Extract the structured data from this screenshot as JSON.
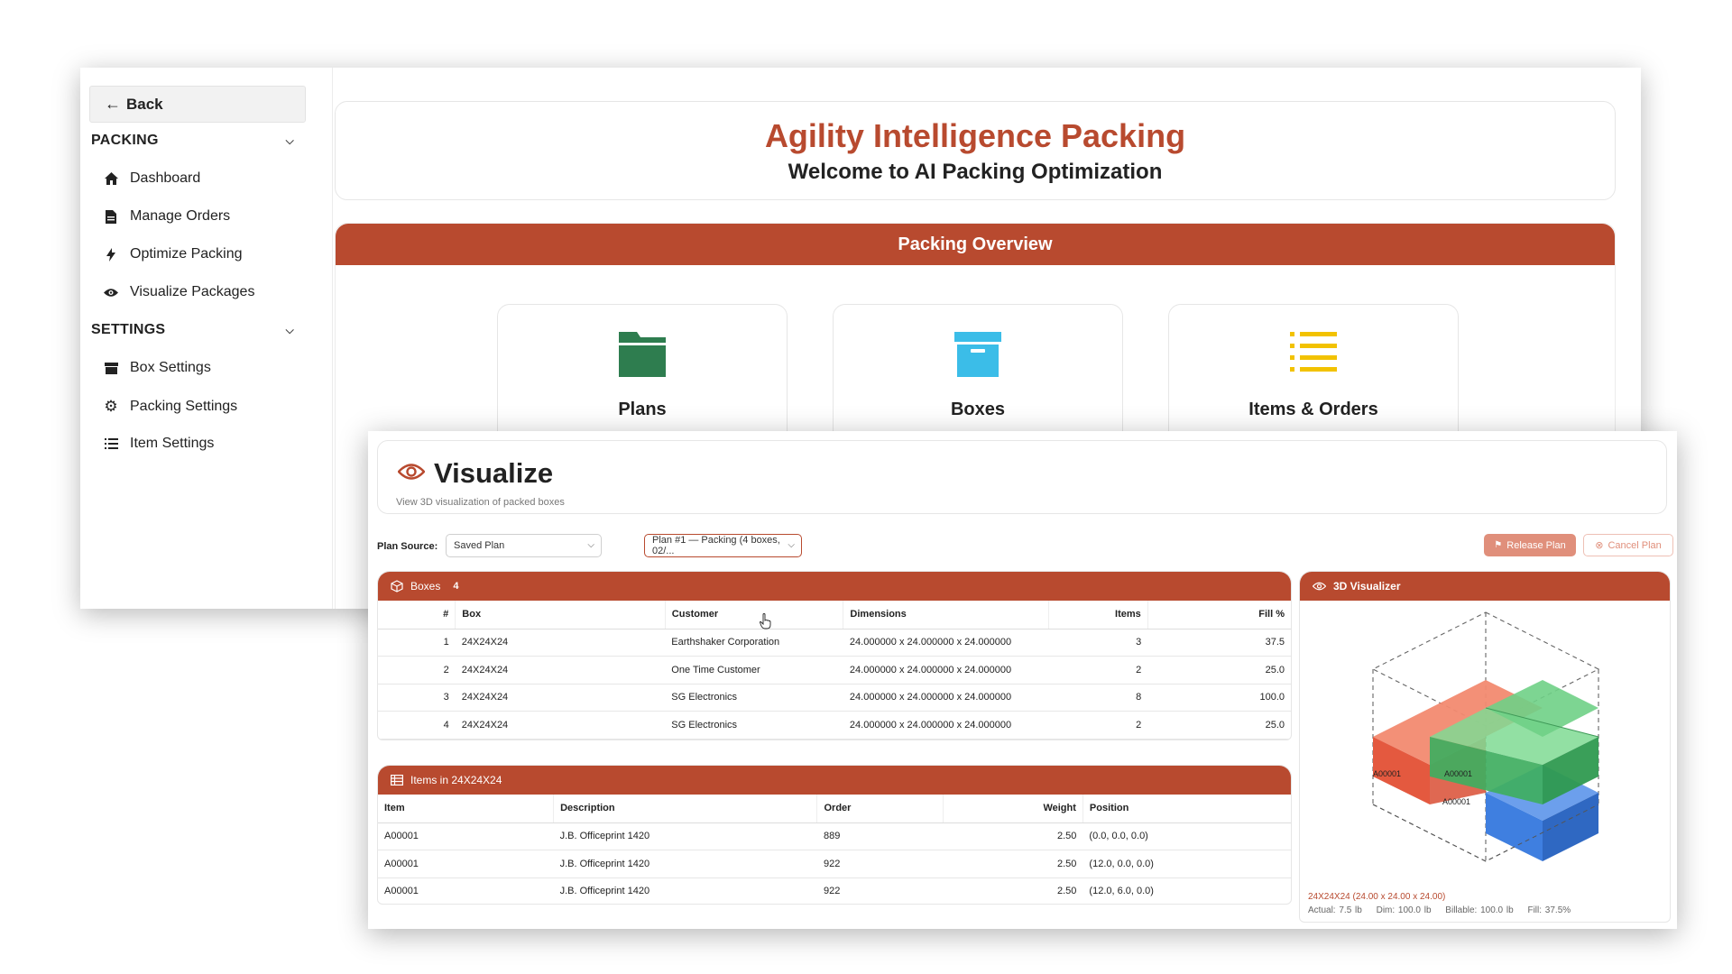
{
  "sidebar": {
    "back_label": "Back",
    "sections": [
      {
        "title": "PACKING",
        "items": [
          {
            "label": "Dashboard",
            "icon": "home-icon"
          },
          {
            "label": "Manage Orders",
            "icon": "document-icon"
          },
          {
            "label": "Optimize Packing",
            "icon": "lightning-icon"
          },
          {
            "label": "Visualize Packages",
            "icon": "eye-icon"
          }
        ]
      },
      {
        "title": "SETTINGS",
        "items": [
          {
            "label": "Box Settings",
            "icon": "box-icon"
          },
          {
            "label": "Packing Settings",
            "icon": "gear-icon"
          },
          {
            "label": "Item Settings",
            "icon": "list-icon"
          }
        ]
      }
    ]
  },
  "hero": {
    "title": "Agility Intelligence Packing",
    "subtitle": "Welcome to AI Packing Optimization"
  },
  "overview": {
    "header": "Packing Overview",
    "cards": [
      {
        "label": "Plans",
        "icon": "folder-icon",
        "color": "#2e7d4f"
      },
      {
        "label": "Boxes",
        "icon": "archive-box-icon",
        "color": "#3bbde8"
      },
      {
        "label": "Items & Orders",
        "icon": "list-icon",
        "color": "#f2c200"
      }
    ]
  },
  "visualize": {
    "title": "Visualize",
    "subtitle": "View 3D visualization of packed boxes",
    "plan_source_label": "Plan Source:",
    "plan_source_value": "Saved Plan",
    "plan_value": "Plan #1 — Packing (4 boxes, 02/...",
    "release_label": "Release Plan",
    "cancel_label": "Cancel Plan",
    "accent": "#b84a2f"
  },
  "boxes_panel": {
    "title": "Boxes",
    "count": "4",
    "columns": [
      "#",
      "Box",
      "Customer",
      "Dimensions",
      "Items",
      "Fill %"
    ],
    "rows": [
      [
        "1",
        "24X24X24",
        "Earthshaker Corporation",
        "24.000000 x 24.000000 x 24.000000",
        "3",
        "37.5"
      ],
      [
        "2",
        "24X24X24",
        "One Time Customer",
        "24.000000 x 24.000000 x 24.000000",
        "2",
        "25.0"
      ],
      [
        "3",
        "24X24X24",
        "SG Electronics",
        "24.000000 x 24.000000 x 24.000000",
        "8",
        "100.0"
      ],
      [
        "4",
        "24X24X24",
        "SG Electronics",
        "24.000000 x 24.000000 x 24.000000",
        "2",
        "25.0"
      ]
    ]
  },
  "items_panel": {
    "title": "Items in 24X24X24",
    "columns": [
      "Item",
      "Description",
      "Order",
      "Weight",
      "Position"
    ],
    "rows": [
      [
        "A00001",
        "J.B. Officeprint 1420",
        "889",
        "2.50",
        "(0.0, 0.0, 0.0)"
      ],
      [
        "A00001",
        "J.B. Officeprint 1420",
        "922",
        "2.50",
        "(12.0, 0.0, 0.0)"
      ],
      [
        "A00001",
        "J.B. Officeprint 1420",
        "922",
        "2.50",
        "(12.0, 6.0, 0.0)"
      ]
    ]
  },
  "visualizer": {
    "title": "3D Visualizer",
    "box_labels": [
      "A00001",
      "A00001",
      "A00001"
    ],
    "box_colors": [
      "#ee6f55",
      "#5cc979",
      "#3f7fe0"
    ],
    "summary": "24X24X24 (24.00 x 24.00 x 24.00)",
    "actual": "Actual: 7.5 lb",
    "dim": "Dim: 100.0 lb",
    "billable": "Billable: 100.0 lb",
    "fill": "Fill: 37.5%"
  }
}
